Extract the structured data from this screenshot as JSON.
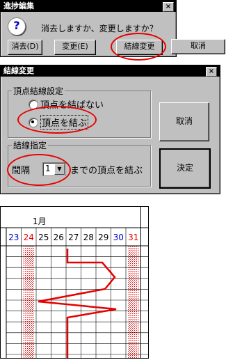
{
  "dialog1": {
    "title": "進捗編集",
    "close_glyph": "×",
    "message": "消去しますか、変更しますか？",
    "icon": "question-icon",
    "icon_glyph": "?",
    "buttons": [
      "消去(D)",
      "変更(E)",
      "結線変更",
      "取消"
    ]
  },
  "dialog2": {
    "title": "結線変更",
    "close_glyph": "×",
    "group1_label": "頂点結線設定",
    "radio1_label": "頂点を結ばない",
    "radio2_label": "頂点を結ぶ",
    "selected_radio": "頂点を結ぶ",
    "group2_label": "結線指定",
    "interval_label": "間隔",
    "interval_value": "1",
    "interval_arrow": "▼",
    "interval_suffix": "までの頂点を結ぶ",
    "cancel_label": "取消",
    "ok_label": "決定"
  },
  "calendar": {
    "month": "1月",
    "days": [
      {
        "d": "23",
        "color": "#0000c8"
      },
      {
        "d": "24",
        "color": "#e60000"
      },
      {
        "d": "25",
        "color": "#000000"
      },
      {
        "d": "26",
        "color": "#000000"
      },
      {
        "d": "27",
        "color": "#000000"
      },
      {
        "d": "28",
        "color": "#000000"
      },
      {
        "d": "29",
        "color": "#000000"
      },
      {
        "d": "30",
        "color": "#0000c8"
      },
      {
        "d": "31",
        "color": "#e60000"
      }
    ],
    "colors": {
      "progress_line": "#e60000",
      "holiday_hatch": "#e60000",
      "grid": "#000000"
    }
  }
}
